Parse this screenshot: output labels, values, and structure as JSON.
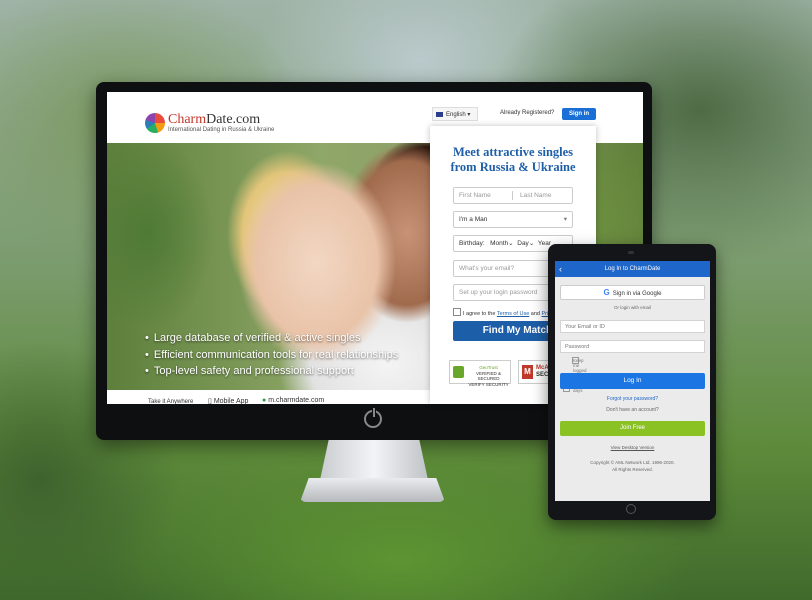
{
  "site": {
    "brand_part1": "Charm",
    "brand_part2": "Date.com",
    "tagline": "International Dating in Russia & Ukraine",
    "language": "English",
    "already_registered": "Already Registered?",
    "sign_in": "Sign in"
  },
  "hero": {
    "bullets": [
      "Large database of verified & active singles",
      "Efficient communication tools for real relationships",
      "Top-level safety and professional support"
    ]
  },
  "bottom_bar": {
    "label": "Take it Anywhere",
    "mobile_app": "Mobile App",
    "mobile_site": "m.charmdate.com"
  },
  "signup_form": {
    "title_line1": "Meet attractive singles",
    "title_line2": "from Russia & Ukraine",
    "first_name_placeholder": "First Name",
    "last_name_placeholder": "Last Name",
    "gender_value": "I'm a Man",
    "birthday_label": "Birthday",
    "month": "Month",
    "day": "Day",
    "year": "Year",
    "email_placeholder": "What's your email?",
    "password_placeholder": "Set up your login password",
    "agree_prefix": "I agree to the",
    "terms_link": "Terms of Use",
    "agree_and": "and",
    "privacy_link": "Privacy",
    "submit": "Find My Matches",
    "badge1_line1": "GeoTrust",
    "badge1_line2": "VERIFIED & SECURED",
    "badge1_line3": "VERIFY SECURITY",
    "badge2_line1": "McAfee",
    "badge2_line2": "SECURE"
  },
  "mobile": {
    "header_title": "Log In to CharmDate",
    "google_button": "Sign in via Google",
    "or_email": "Or login with email",
    "email_placeholder": "Your Email or ID",
    "password_placeholder": "Password",
    "keep_logged": "Keep me logged in for 30 days",
    "login_button": "Log In",
    "forgot": "Forgot your password?",
    "no_account": "Don't have an account?",
    "join_button": "Join Free",
    "desktop_link": "View Desktop Version",
    "copyright_line1": "Copyright © AML Network Ltd. 1996-2020.",
    "copyright_line2": "All Rights Reserved."
  },
  "colors": {
    "brand_red": "#c0392b",
    "primary_blue": "#1d5ea8",
    "join_green": "#8ac224"
  }
}
